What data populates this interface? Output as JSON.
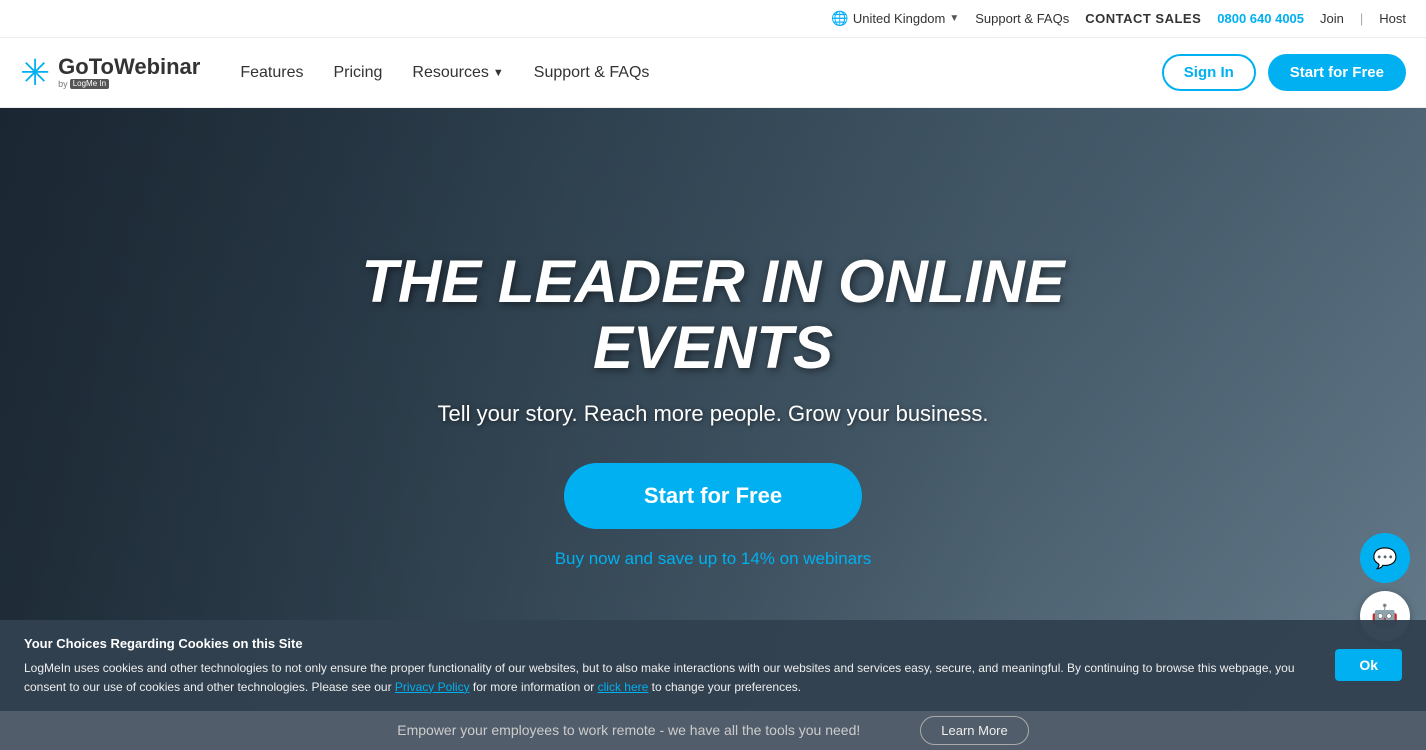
{
  "topbar": {
    "region": "United Kingdom",
    "support_faqs": "Support & FAQs",
    "contact_sales": "CONTACT SALES",
    "phone": "0800 640 4005",
    "join": "Join",
    "host": "Host"
  },
  "navbar": {
    "logo_brand": "GoToWebinar",
    "logo_by": "by",
    "logo_logmein": "LogMe In",
    "features": "Features",
    "pricing": "Pricing",
    "resources": "Resources",
    "support_faqs": "Support & FAQs",
    "signin": "Sign In",
    "start_free": "Start for Free"
  },
  "hero": {
    "title": "THE LEADER IN ONLINE EVENTS",
    "subtitle": "Tell your story. Reach more people. Grow your business.",
    "cta": "Start for Free",
    "save_link": "Buy now and save up to 14% on webinars"
  },
  "bottom": {
    "text": "Empower your employees to work remote - we have all the tools you need!",
    "learn_more": "Learn More"
  },
  "cookie": {
    "title": "Your Choices Regarding Cookies on this Site",
    "body": "LogMeIn uses cookies and other technologies to not only ensure the proper functionality of our websites, but to also make interactions with our websites and services easy, secure, and meaningful. By continuing to browse this webpage, you consent to our use of cookies and other technologies. Please see our ",
    "privacy_link": "Privacy Policy",
    "middle": " for more information or ",
    "click_link": "click here",
    "end": " to change your preferences.",
    "ok": "Ok"
  }
}
